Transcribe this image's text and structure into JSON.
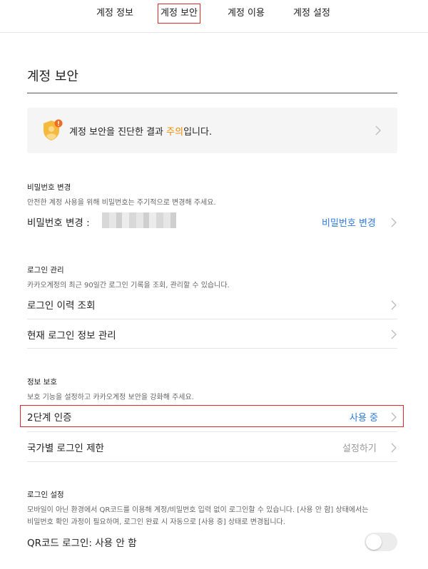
{
  "tabs": [
    "계정 정보",
    "계정 보안",
    "계정 이용",
    "계정 설정"
  ],
  "active_tab_index": 1,
  "page_title": "계정 보안",
  "banner": {
    "prefix": "계정 보안을 진단한 결과 ",
    "status": "주의",
    "suffix": "입니다.",
    "status_color": "#f28b00"
  },
  "password": {
    "section_title": "비밀번호 변경",
    "description": "안전한 계정 사용을 위해 비밀번호는 주기적으로 변경해 주세요.",
    "row_label": "비밀번호 변경 :",
    "action_label": "비밀번호 변경"
  },
  "login": {
    "section_title": "로그인 관리",
    "description": "카카오계정의 최근 90일간 로그인 기록을 조회, 관리할 수 있습니다.",
    "history_label": "로그인 이력 조회",
    "current_label": "현재 로그인 정보 관리"
  },
  "protection": {
    "section_title": "정보 보호",
    "description": "보호 기능을 설정하고 카카오계정 보안을 강화해 주세요.",
    "two_step_label": "2단계 인증",
    "two_step_status": "사용 중",
    "country_label": "국가별 로그인 제한",
    "country_action": "설정하기"
  },
  "login_settings": {
    "section_title": "로그인 설정",
    "description_line1": "모바일이 아닌 환경에서 QR코드를 이용해 계정/비밀번호 입력 없이 로그인할 수 있습니다. [사용 안 함] 상태에서는",
    "description_line2": "비밀번호 확인 과정이 필요하며, 로그인 완료 시 자동으로 [사용 중] 상태로 변경됩니다.",
    "qr_label": "QR코드 로그인: 사용 안 함",
    "qr_enabled": false
  },
  "colors": {
    "accent_blue": "#2e7ad6",
    "highlight_red": "#e0282d",
    "warning_orange": "#f28b00"
  }
}
